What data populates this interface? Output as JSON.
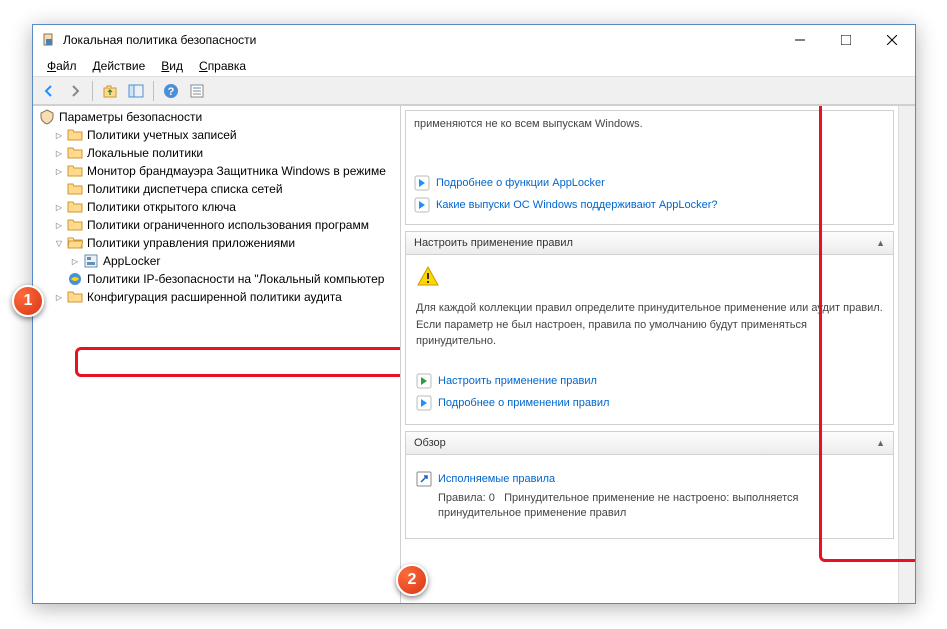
{
  "window": {
    "title": "Локальная политика безопасности"
  },
  "menu": {
    "file": "Файл",
    "action": "Действие",
    "view": "Вид",
    "help": "Справка"
  },
  "tree": {
    "root": "Параметры безопасности",
    "items": [
      "Политики учетных записей",
      "Локальные политики",
      "Монитор брандмауэра Защитника Windows в режиме",
      "Политики диспетчера списка сетей",
      "Политики открытого ключа",
      "Политики ограниченного использования программ",
      "Политики управления приложениями",
      "AppLocker",
      "Политики IP-безопасности на \"Локальный компьютер",
      "Конфигурация расширенной политики аудита"
    ]
  },
  "detail": {
    "top_text": "применяются не ко всем выпускам Windows.",
    "link_more": "Подробнее о функции AppLocker",
    "link_editions": "Какие выпуски ОС Windows поддерживают AppLocker?",
    "section1_title": "Настроить применение правил",
    "section1_text": "Для каждой коллекции правил определите принудительное применение или аудит правил. Если параметр не был настроен, правила по умолчанию будут применяться принудительно.",
    "link_configure": "Настроить применение правил",
    "link_about_enforce": "Подробнее о применении правил",
    "section2_title": "Обзор",
    "rule_title": "Исполняемые правила",
    "rule_count_label": "Правила:",
    "rule_count": "0",
    "rule_status": "Принудительное применение не настроено: выполняется принудительное применение правил"
  },
  "badges": {
    "one": "1",
    "two": "2"
  }
}
